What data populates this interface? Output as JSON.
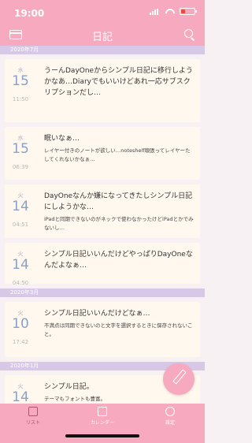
{
  "status": {
    "time": "19:00"
  },
  "nav": {
    "title": "日記"
  },
  "sections": [
    {
      "header": "2020年7月",
      "entries": [
        {
          "dow": "水",
          "day": "15",
          "time": "11:50",
          "title": "うーんDayOneからシンプル日記に移行しようかなあ…Diaryでもいいけどあれ一応サブスクリプションだし…",
          "body": ""
        },
        {
          "dow": "水",
          "day": "15",
          "time": "06:39",
          "title": "眠いなぁ…",
          "body": "レイヤー付きのノートが欲しい…noteshelf頑張ってレイヤーたしてくれないかなぁ…"
        },
        {
          "dow": "火",
          "day": "14",
          "time": "04:51",
          "title": "DayOneなんか嫌になってきたしシンプル日記にしようかな…",
          "body": "iPadと同期できないのがネックで使わなかったけどiPadとかでみないし…"
        },
        {
          "dow": "火",
          "day": "14",
          "time": "04:50",
          "title": "シンプル日記いいんだけどやっぱりDayOneなんだよなぁ…",
          "body": ""
        }
      ]
    },
    {
      "header": "2020年3月",
      "entries": [
        {
          "dow": "火",
          "day": "10",
          "time": "17:42",
          "title": "シンプル日記いいんだけどなぁ…",
          "body": "不満点は同期できないのと文字を選択するときに保存されないこと。"
        }
      ]
    },
    {
      "header": "2020年1月",
      "entries": [
        {
          "dow": "火",
          "day": "14",
          "time": "",
          "title": "シンプル日記。",
          "body": "テーマもフォントも豊富。\n日本製アプリ。"
        }
      ]
    }
  ],
  "tabbar": {
    "list": "リスト",
    "calendar": "カレンダー",
    "settings": "設定"
  },
  "colors": {
    "accent": "#f6a9bf",
    "section": "#d8c8e8",
    "card": "#fff8ee"
  }
}
